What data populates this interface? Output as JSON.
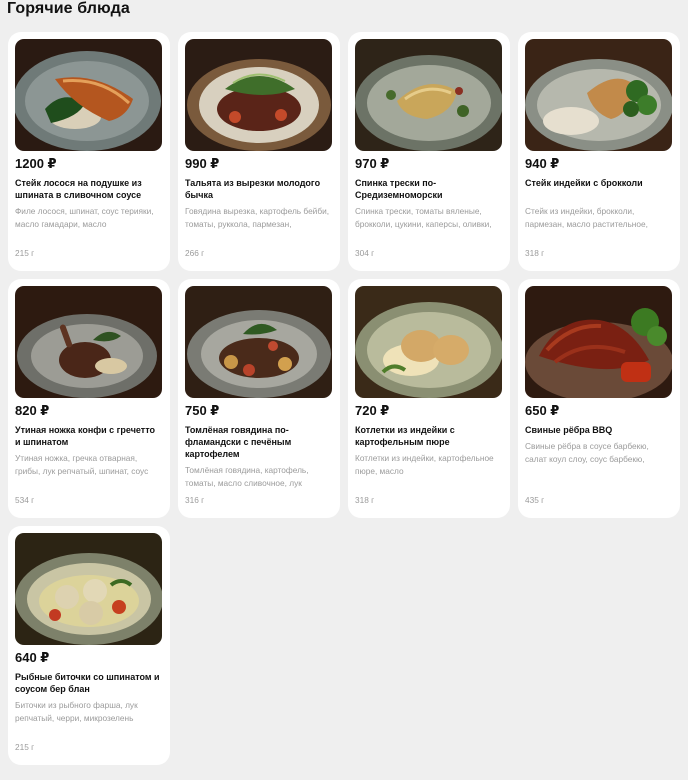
{
  "page": {
    "title": "Горячие блюда"
  },
  "currency": "₽",
  "dishes": [
    {
      "price": "1200 ₽",
      "name": "Стейк лосося на подушке из шпината в сливочном соусе",
      "description": "Филе лосося, шпинат, соус терияки, масло гамадари, масло",
      "weight": "215 г",
      "image": "salmon-steak-photo"
    },
    {
      "price": "990 ₽",
      "name": "Тальята из вырезки молодого бычка",
      "description": "Говядина вырезка, картофель бейби, томаты, руккола, пармезан,",
      "weight": "266 г",
      "image": "tagliata-photo"
    },
    {
      "price": "970 ₽",
      "name": "Спинка трески по-Средиземноморски",
      "description": "Спинка трески, томаты вяленые, брокколи, цукини, каперсы, оливки,",
      "weight": "304 г",
      "image": "cod-photo"
    },
    {
      "price": "940 ₽",
      "name": "Стейк индейки с брокколи",
      "description": "Стейк из индейки, брокколи, пармезан, масло растительное,",
      "weight": "318 г",
      "image": "turkey-steak-photo"
    },
    {
      "price": "820 ₽",
      "name": "Утиная ножка конфи с гречетто и шпинатом",
      "description": "Утиная ножка, гречка отварная, грибы, лук репчатый, шпинат, соус",
      "weight": "534 г",
      "image": "duck-leg-photo"
    },
    {
      "price": "750 ₽",
      "name": "Томлёная говядина по-фламандски с печёным картофелем",
      "description": "Томлёная говядина, картофель, томаты, масло сливочное, лук",
      "weight": "316 г",
      "image": "braised-beef-photo"
    },
    {
      "price": "720 ₽",
      "name": "Котлетки из индейки с картофельным пюре",
      "description": "Котлетки из индейки, картофельное пюре, масло",
      "weight": "318 г",
      "image": "turkey-cutlets-photo"
    },
    {
      "price": "650 ₽",
      "name": "Свиные рёбра BBQ",
      "description": "Свиные рёбра в соусе барбекю, салат коул слоу, соус барбекю,",
      "weight": "435 г",
      "image": "pork-ribs-photo"
    },
    {
      "price": "640 ₽",
      "name": "Рыбные биточки со шпинатом и соусом бер блан",
      "description": "Биточки из рыбного фарша, лук репчатый, черри, микрозелень",
      "weight": "215 г",
      "image": "fish-cakes-photo"
    }
  ]
}
